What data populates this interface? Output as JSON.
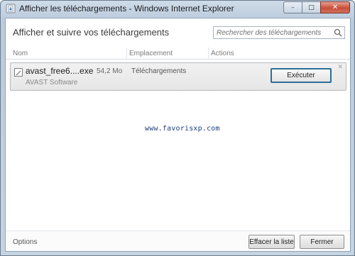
{
  "window": {
    "title": "Afficher les téléchargements - Windows Internet Explorer",
    "controls": {
      "minimize": "–",
      "maximize": "□",
      "close": "✕"
    }
  },
  "main": {
    "heading": "Afficher et suivre vos téléchargements",
    "search": {
      "placeholder": "Rechercher des téléchargements",
      "value": ""
    }
  },
  "columns": [
    "Nom",
    "Emplacement",
    "Actions"
  ],
  "downloads": [
    {
      "name": "avast_free6....exe",
      "size": "54,2 Mo",
      "location": "Téléchargements",
      "publisher": "AVAST Software",
      "action_label": "Exécuter",
      "dismiss": "✕"
    }
  ],
  "watermark": "www.favorisxp.com",
  "footer": {
    "options_label": "Options",
    "clear_label": "Effacer la liste",
    "close_label": "Fermer"
  },
  "colors": {
    "accent_border": "#2e6d99",
    "close_button": "#c7503a",
    "watermark": "#1c3f7a"
  },
  "icons": [
    "ie-icon",
    "search-icon",
    "file-icon",
    "close-icon"
  ]
}
